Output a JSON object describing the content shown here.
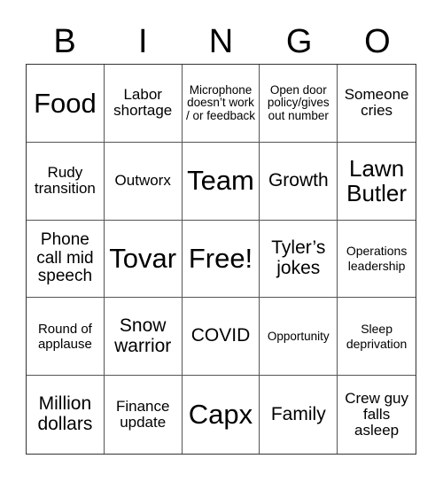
{
  "header": {
    "letters": [
      "B",
      "I",
      "N",
      "G",
      "O"
    ]
  },
  "cells": [
    "Food",
    "Labor shortage",
    "Microphone doesn’t work / or feedback",
    "Open door policy/gives out number",
    "Someone cries",
    "Rudy transition",
    "Outworx",
    "Team",
    "Growth",
    "Lawn Butler",
    "Phone call mid speech",
    "Tovar",
    "Free!",
    "Tyler’s jokes",
    "Operations leadership",
    "Round of applause",
    "Snow warrior",
    "COVID",
    "Opportunity",
    "Sleep deprivation",
    "Million dollars",
    "Finance update",
    "Capx",
    "Family",
    "Crew guy falls asleep"
  ]
}
